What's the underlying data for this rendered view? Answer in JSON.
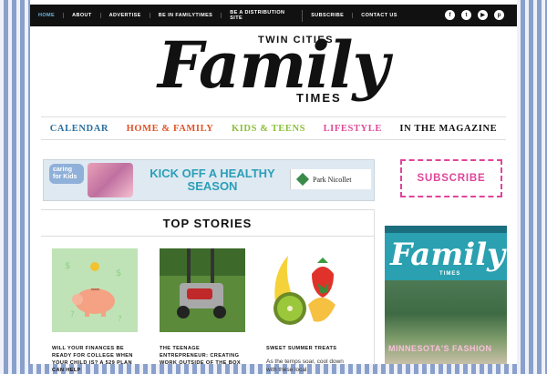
{
  "topnav": {
    "items": [
      {
        "label": "HOME",
        "active": true
      },
      {
        "label": "ABOUT",
        "active": false
      },
      {
        "label": "ADVERTISE",
        "active": false
      },
      {
        "label": "BE IN FAMILYTIMES",
        "active": false
      },
      {
        "label": "BE A DISTRIBUTION SITE",
        "active": false
      },
      {
        "label": "SUBSCRIBE",
        "active": false
      },
      {
        "label": "CONTACT US",
        "active": false
      }
    ],
    "social": [
      {
        "icon": "facebook-icon",
        "glyph": "f"
      },
      {
        "icon": "twitter-icon",
        "glyph": "t"
      },
      {
        "icon": "youtube-icon",
        "glyph": "▶"
      },
      {
        "icon": "pinterest-icon",
        "glyph": "p"
      }
    ]
  },
  "logo": {
    "top": "TWIN CITIES",
    "main": "Family",
    "bottom": "TIMES"
  },
  "categories": [
    {
      "label": "CALENDAR",
      "color": "#2a6f9e"
    },
    {
      "label": "HOME & FAMILY",
      "color": "#e0542a"
    },
    {
      "label": "KIDS & TEENS",
      "color": "#8cbf3a"
    },
    {
      "label": "LIFESTYLE",
      "color": "#e04a9a"
    },
    {
      "label": "IN THE MAGAZINE",
      "color": "#111111"
    }
  ],
  "banner": {
    "badge": "caring for Kids",
    "headline": "KICK OFF A HEALTHY SEASON",
    "sponsor": "Park Nicollet"
  },
  "subscribe": {
    "label": "SUBSCRIBE"
  },
  "stories": {
    "heading": "TOP STORIES",
    "items": [
      {
        "title": "WILL YOUR FINANCES BE READY FOR COLLEGE WHEN YOUR CHILD IS? A 529 PLAN CAN HELP",
        "excerpt": ""
      },
      {
        "title": "THE TEENAGE ENTREPRENEUR: CREATING WORK OUTSIDE OF THE BOX",
        "excerpt": ""
      },
      {
        "title": "SWEET SUMMER TREATS",
        "excerpt": "As the temps soar, cool down with these local"
      }
    ]
  },
  "magazine": {
    "title": "Family",
    "subtitle": "TIMES",
    "cover_line": "MINNESOTA'S FASHION"
  }
}
